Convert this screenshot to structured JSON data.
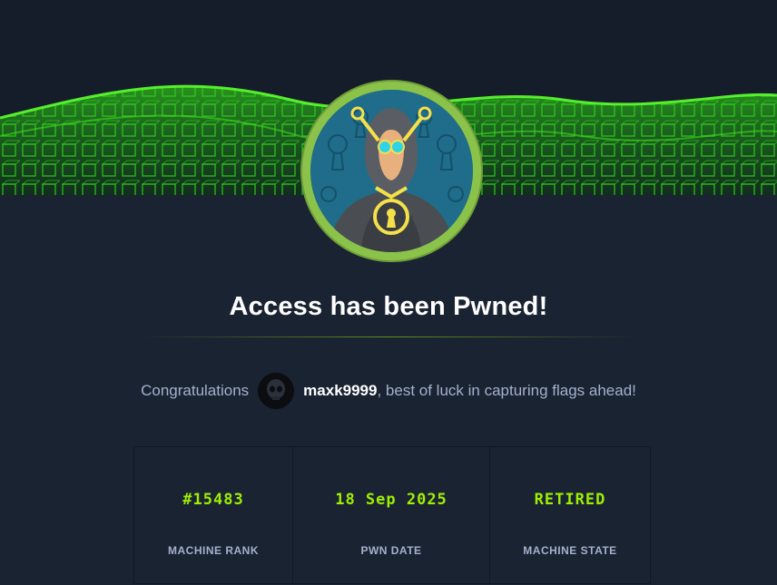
{
  "banner": {
    "machine_avatar": "hooded-figure-with-keys-illustration"
  },
  "title": "Access has been Pwned!",
  "congrats": {
    "prefix": "Congratulations",
    "username": "maxk9999",
    "suffix": ", best of luck in capturing flags ahead!"
  },
  "stats": [
    {
      "value": "#15483",
      "label": "MACHINE RANK"
    },
    {
      "value": "18 Sep 2025",
      "label": "PWN DATE"
    },
    {
      "value": "RETIRED",
      "label": "MACHINE STATE"
    }
  ],
  "colors": {
    "accent": "#9fef00",
    "background": "#1a2332",
    "ring": "#8bc34a",
    "muted_text": "#a4b1cd"
  }
}
